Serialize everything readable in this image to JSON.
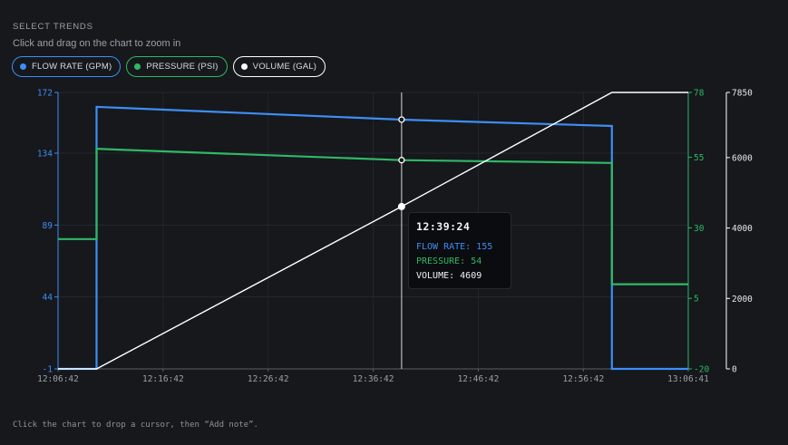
{
  "header": {
    "section_title": "SELECT TRENDS",
    "hint": "Click and drag on the chart to zoom in"
  },
  "pills": [
    {
      "label": "FLOW RATE (GPM)",
      "color": "#3d8ef5"
    },
    {
      "label": "PRESSURE (PSI)",
      "color": "#2fb866"
    },
    {
      "label": "VOLUME (GAL)",
      "color": "#ffffff"
    }
  ],
  "footer": "Click the chart to drop a cursor, then “Add note”.",
  "tooltip": {
    "time": "12:39:24",
    "flow": "FLOW RATE: 155",
    "pressure": "PRESSURE: 54",
    "volume": "VOLUME: 4609"
  },
  "chart_data": {
    "type": "line",
    "grid": true,
    "x_range": [
      "12:06:42",
      "13:06:41"
    ],
    "x_ticks": [
      "12:06:42",
      "12:16:42",
      "12:26:42",
      "12:36:42",
      "12:46:42",
      "12:56:42",
      "13:06:41"
    ],
    "cursor_time": "12:39:24",
    "axes": {
      "flow": {
        "ticks": [
          "172",
          "134",
          "89",
          "44",
          "-1"
        ],
        "range": [
          -1,
          172
        ],
        "color": "#3d8ef5"
      },
      "pressure": {
        "ticks": [
          "78",
          "55",
          "30",
          "5",
          "-20"
        ],
        "range": [
          -20,
          78
        ],
        "color": "#2fb866"
      },
      "volume": {
        "ticks": [
          "7850",
          "6000",
          "4000",
          "2000",
          "0"
        ],
        "range": [
          0,
          7850
        ],
        "color": "#ffffff"
      }
    },
    "series": [
      {
        "name": "FLOW RATE (GPM)",
        "axis": "flow",
        "color": "#3d8ef5",
        "points": [
          [
            "12:06:42",
            -1
          ],
          [
            "12:10:22",
            -1
          ],
          [
            "12:10:22",
            163
          ],
          [
            "12:39:24",
            155
          ],
          [
            "12:59:25",
            151
          ],
          [
            "12:59:25",
            -1
          ],
          [
            "13:06:41",
            -1
          ]
        ]
      },
      {
        "name": "PRESSURE (PSI)",
        "axis": "pressure",
        "color": "#2fb866",
        "points": [
          [
            "12:06:42",
            26
          ],
          [
            "12:10:22",
            26
          ],
          [
            "12:10:22",
            58
          ],
          [
            "12:39:24",
            54
          ],
          [
            "12:59:25",
            53
          ],
          [
            "12:59:25",
            10
          ],
          [
            "13:06:41",
            10
          ]
        ]
      },
      {
        "name": "VOLUME (GAL)",
        "axis": "volume",
        "color": "#ffffff",
        "points": [
          [
            "12:06:42",
            0
          ],
          [
            "12:10:22",
            0
          ],
          [
            "12:39:24",
            4609
          ],
          [
            "12:59:25",
            7850
          ],
          [
            "13:06:41",
            7850
          ]
        ]
      }
    ]
  }
}
